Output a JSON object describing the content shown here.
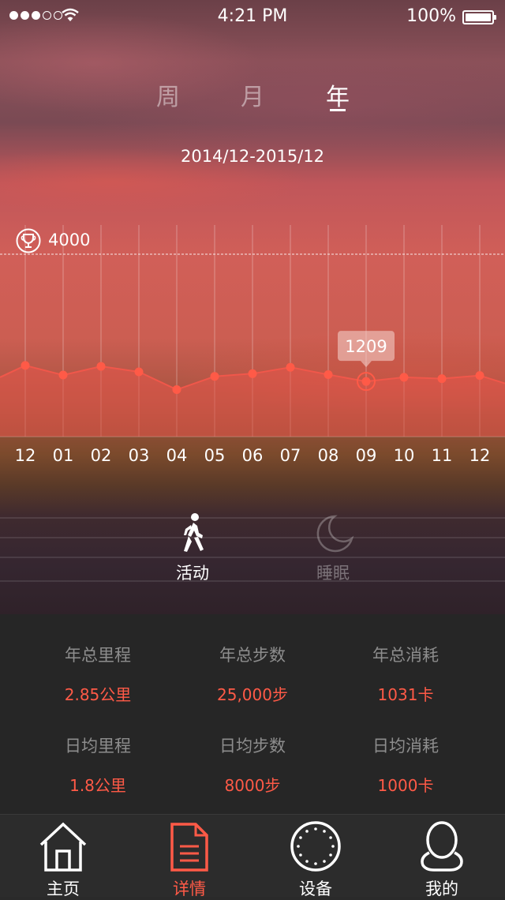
{
  "status_bar": {
    "time": "4:21 PM",
    "battery": "100%"
  },
  "period_tabs": [
    {
      "label": "周",
      "active": false
    },
    {
      "label": "月",
      "active": false
    },
    {
      "label": "年",
      "active": true
    }
  ],
  "date_range": "2014/12-2015/12",
  "goal": {
    "label": "4000",
    "value": 4000
  },
  "chart_data": {
    "type": "area",
    "categories": [
      "12",
      "01",
      "02",
      "03",
      "04",
      "05",
      "06",
      "07",
      "08",
      "09",
      "10",
      "11",
      "12"
    ],
    "values": [
      1560,
      1350,
      1540,
      1420,
      1030,
      1320,
      1380,
      1520,
      1360,
      1209,
      1300,
      1270,
      1340
    ],
    "highlight": {
      "index": 9,
      "label": "1209"
    },
    "ylim": [
      0,
      4000
    ],
    "grid": true,
    "colors": {
      "fill": "#e8564a",
      "line": "#f0574a",
      "point": "#ff5a47"
    }
  },
  "modes": [
    {
      "label": "活动",
      "icon": "walking-icon",
      "active": true
    },
    {
      "label": "睡眠",
      "icon": "moon-icon",
      "active": false
    }
  ],
  "stats": [
    {
      "title": "年总里程",
      "value": "2.85公里"
    },
    {
      "title": "年总步数",
      "value": "25,000步"
    },
    {
      "title": "年总消耗",
      "value": "1031卡"
    },
    {
      "title": "日均里程",
      "value": "1.8公里"
    },
    {
      "title": "日均步数",
      "value": "8000步"
    },
    {
      "title": "日均消耗",
      "value": "1000卡"
    }
  ],
  "tabbar": [
    {
      "label": "主页",
      "icon": "home-icon",
      "active": false
    },
    {
      "label": "详情",
      "icon": "document-icon",
      "active": true
    },
    {
      "label": "设备",
      "icon": "device-icon",
      "active": false
    },
    {
      "label": "我的",
      "icon": "user-icon",
      "active": false
    }
  ],
  "accent_color": "#ff5a47"
}
